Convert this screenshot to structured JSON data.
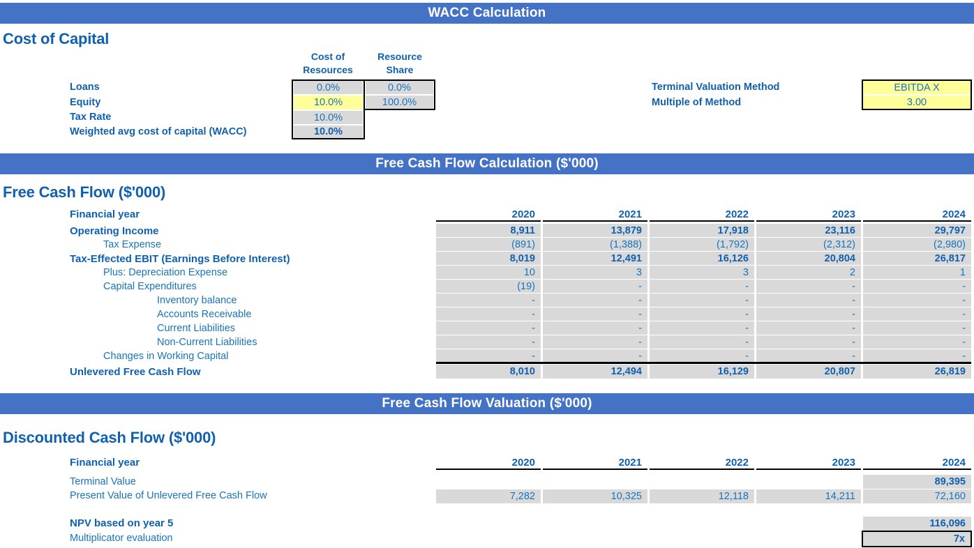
{
  "banners": {
    "wacc": "WACC Calculation",
    "fcf_calc": "Free Cash Flow Calculation ($'000)",
    "fcf_val": "Free Cash Flow Valuation ($'000)"
  },
  "cost_of_capital": {
    "title": "Cost of Capital",
    "column_headers": {
      "cost_of_resources": "Cost of\nResources",
      "cost_of_resources_l1": "Cost of",
      "cost_of_resources_l2": "Resources",
      "resource_share_l1": "Resource",
      "resource_share_l2": "Share"
    },
    "rows": [
      {
        "label": "Loans",
        "cost": "0.0%",
        "share": "0.0%"
      },
      {
        "label": "Equity",
        "cost": "10.0%",
        "share": "100.0%"
      },
      {
        "label": "Tax Rate",
        "cost": "10.0%",
        "share": ""
      },
      {
        "label": "Weighted avg cost of capital (WACC)",
        "cost": "10.0%",
        "share": ""
      }
    ]
  },
  "terminal": {
    "method_label": "Terminal Valuation Method",
    "method_value": "EBITDA X",
    "multiple_label": "Multiple of Method",
    "multiple_value": "3.00"
  },
  "free_cash_flow": {
    "title": "Free Cash Flow ($'000)",
    "year_label": "Financial year",
    "years": [
      "2020",
      "2021",
      "2022",
      "2023",
      "2024"
    ],
    "rows": [
      {
        "label": "Operating Income",
        "indent": 0,
        "bold": true,
        "values": [
          "8,911",
          "13,879",
          "17,918",
          "23,116",
          "29,797"
        ]
      },
      {
        "label": "Tax Expense",
        "indent": 1,
        "bold": false,
        "values": [
          "(891)",
          "(1,388)",
          "(1,792)",
          "(2,312)",
          "(2,980)"
        ]
      },
      {
        "label": "Tax-Effected EBIT (Earnings Before Interest)",
        "indent": 0,
        "bold": true,
        "values": [
          "8,019",
          "12,491",
          "16,126",
          "20,804",
          "26,817"
        ]
      },
      {
        "label": "Plus: Depreciation Expense",
        "indent": 1,
        "bold": false,
        "values": [
          "10",
          "3",
          "3",
          "2",
          "1"
        ]
      },
      {
        "label": "Capital Expenditures",
        "indent": 1,
        "bold": false,
        "values": [
          "(19)",
          "-",
          "-",
          "-",
          "-"
        ]
      },
      {
        "label": "Inventory balance",
        "indent": 2,
        "bold": false,
        "values": [
          "-",
          "-",
          "-",
          "-",
          "-"
        ]
      },
      {
        "label": "Accounts Receivable",
        "indent": 2,
        "bold": false,
        "values": [
          "-",
          "-",
          "-",
          "-",
          "-"
        ]
      },
      {
        "label": "Current Liabilities",
        "indent": 2,
        "bold": false,
        "values": [
          "-",
          "-",
          "-",
          "-",
          "-"
        ]
      },
      {
        "label": "Non-Current Liabilities",
        "indent": 2,
        "bold": false,
        "values": [
          "-",
          "-",
          "-",
          "-",
          "-"
        ]
      },
      {
        "label": "Changes in Working Capital",
        "indent": 1,
        "bold": false,
        "values": [
          "-",
          "-",
          "-",
          "-",
          "-"
        ]
      }
    ],
    "total_row": {
      "label": "Unlevered Free Cash Flow",
      "values": [
        "8,010",
        "12,494",
        "16,129",
        "20,807",
        "26,819"
      ]
    }
  },
  "discounted_cash_flow": {
    "title": "Discounted Cash Flow ($'000)",
    "year_label": "Financial year",
    "years": [
      "2020",
      "2021",
      "2022",
      "2023",
      "2024"
    ],
    "rows": [
      {
        "label": "Terminal Value",
        "bold": true,
        "values": [
          "",
          "",
          "",
          "",
          "89,395"
        ]
      },
      {
        "label": "Present Value of Unlevered Free Cash Flow",
        "bold": false,
        "values": [
          "7,282",
          "10,325",
          "12,118",
          "14,211",
          "72,160"
        ]
      }
    ],
    "npv": {
      "label": "NPV based on year 5",
      "value": "116,096"
    },
    "multiplicator": {
      "label": "Multiplicator evaluation",
      "value": "7x"
    }
  },
  "colors": {
    "banner_blue": "#4472c4",
    "text_blue": "#1874bd",
    "heading_blue": "#1060b0",
    "cell_gray": "#d9d9d9",
    "input_yellow": "#ffff99"
  }
}
